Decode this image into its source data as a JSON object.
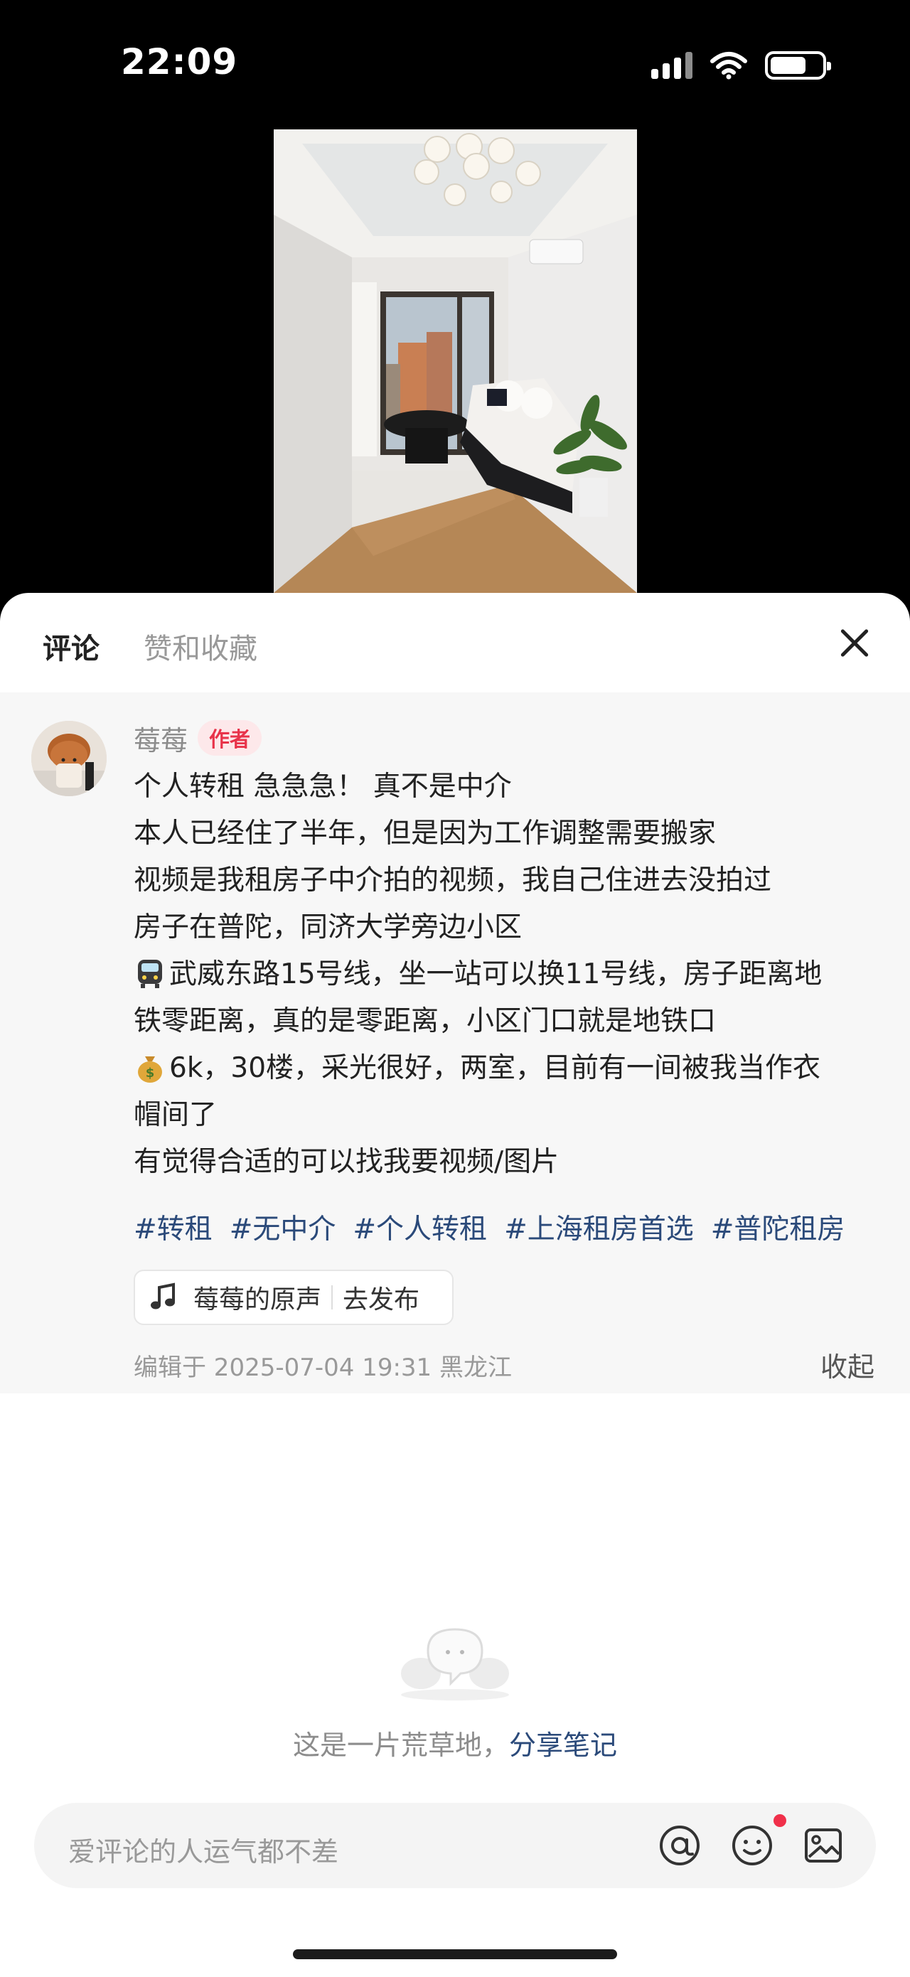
{
  "status": {
    "time": "22:09"
  },
  "tabs": {
    "comments": "评论",
    "likes": "赞和收藏"
  },
  "post": {
    "author": "莓莓",
    "badge": "作者",
    "lines": [
      "个人转租 急急急！ 真不是中介",
      "本人已经住了半年，但是因为工作调整需要搬家",
      "视频是我租房子中介拍的视频，我自己住进去没拍过",
      "房子在普陀，同济大学旁边小区",
      "武威东路15号线，坐一站可以换11号线，房子距离地",
      "铁零距离，真的是零距离，小区门口就是地铁口",
      "6k，30楼，采光很好，两室，目前有一间被我当作衣",
      "帽间了",
      "有觉得合适的可以找我要视频/图片"
    ],
    "tags": [
      "#转租",
      "#无中介",
      "#个人转租",
      "#上海租房首选",
      "#普陀租房"
    ],
    "sound": {
      "name": "莓莓的原声",
      "action": "去发布"
    },
    "meta": "编辑于  2025-07-04 19:31 黑龙江",
    "collapse": "收起"
  },
  "empty": {
    "text": "这是一片荒草地，",
    "link": "分享笔记"
  },
  "comment_input": {
    "placeholder": "爱评论的人运气都不差"
  },
  "icons": {
    "train": "metro-train-emoji",
    "bag": "money-bag-emoji",
    "note": "music-note-icon",
    "at": "at-icon",
    "emoji": "emoji-icon",
    "image": "image-icon",
    "close": "close-icon"
  },
  "colors": {
    "badge": "#e8334a",
    "tag": "#2b4a7a",
    "dot": "#f0304a"
  }
}
